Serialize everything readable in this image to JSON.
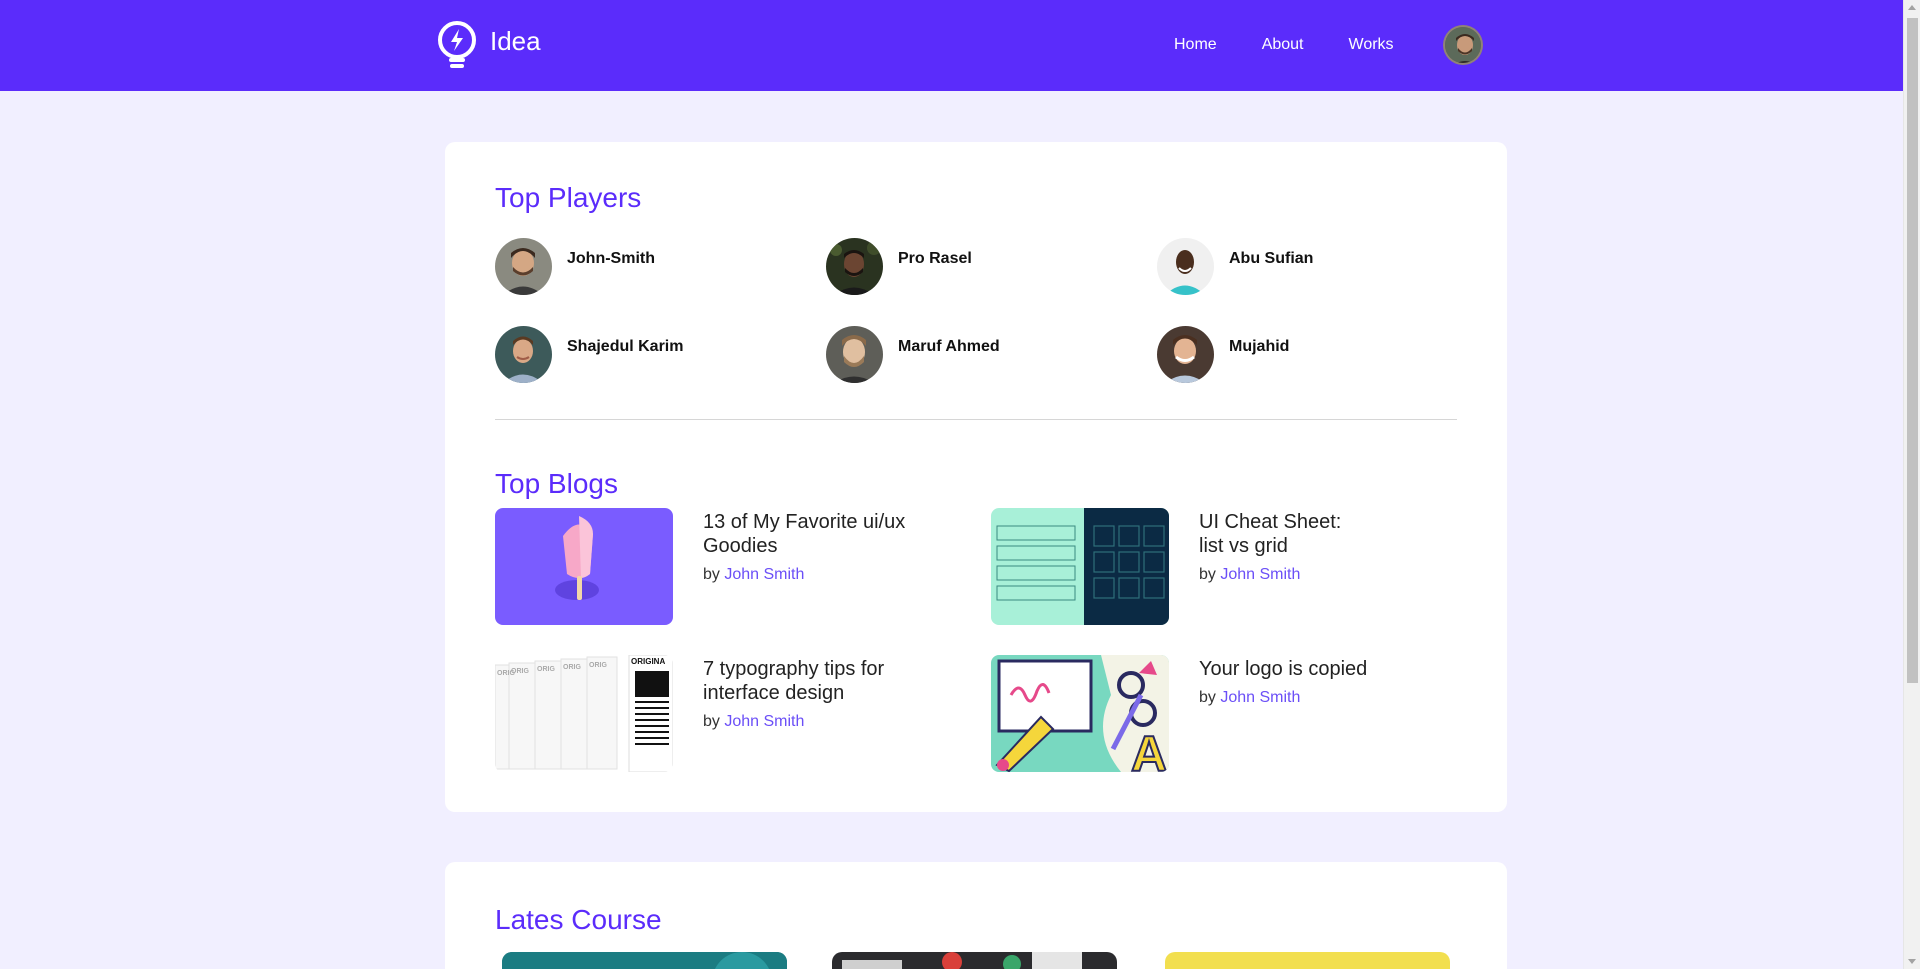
{
  "header": {
    "brand": "Idea",
    "nav": [
      "Home",
      "About",
      "Works"
    ]
  },
  "top_players": {
    "title": "Top Players",
    "players": [
      {
        "name": "John-Smith"
      },
      {
        "name": "Pro Rasel"
      },
      {
        "name": "Abu Sufian"
      },
      {
        "name": "Shajedul Karim"
      },
      {
        "name": "Maruf Ahmed"
      },
      {
        "name": "Mujahid"
      }
    ]
  },
  "top_blogs": {
    "title": "Top Blogs",
    "by_label": "by",
    "blogs": [
      {
        "title": "13 of My Favorite ui/ux Goodies",
        "author": "John Smith"
      },
      {
        "title": "UI Cheat Sheet: list vs grid",
        "author": "John Smith"
      },
      {
        "title": "7 typography tips for interface design",
        "author": "John Smith"
      },
      {
        "title": "Your logo is copied",
        "author": "John Smith"
      }
    ]
  },
  "latest_course": {
    "title": "Lates Course"
  },
  "thumb_text": {
    "typography_label": "ORIGINA",
    "typography_small": "ORIG"
  },
  "colors": {
    "brand": "#5b2cfb",
    "background": "#f1efff",
    "author_link": "#6b4ff7"
  }
}
